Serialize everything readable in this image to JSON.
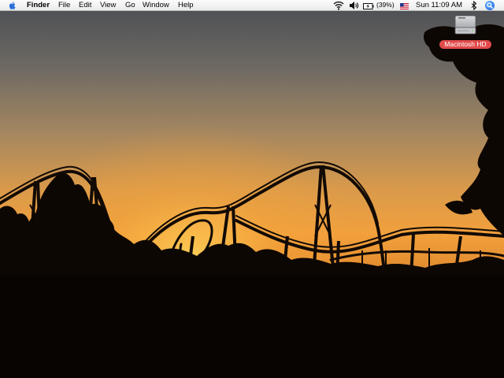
{
  "menubar": {
    "apple_icon": "apple-logo",
    "app_name": "Finder",
    "menus": [
      "File",
      "Edit",
      "View",
      "Go",
      "Window",
      "Help"
    ],
    "status": {
      "wifi_icon": "wifi-icon",
      "volume_icon": "volume-icon",
      "battery_icon": "battery-charging-icon",
      "battery_percent": "(39%)",
      "input_flag_icon": "us-flag-icon",
      "clock": "Sun 11:09 AM",
      "bluetooth_icon": "bluetooth-icon",
      "spotlight_icon": "spotlight-icon"
    }
  },
  "desktop": {
    "icons": [
      {
        "label": "Macintosh HD",
        "icon": "hard-drive-icon",
        "selected": true
      }
    ],
    "wallpaper": "roller-coaster-sunset-silhouette"
  },
  "colors": {
    "sky_top": "#4d4f55",
    "sky_mid": "#b78d58",
    "sky_glow": "#f7a33a",
    "selection_label": "#e24a4a",
    "menubar": "#f2f2f2"
  }
}
